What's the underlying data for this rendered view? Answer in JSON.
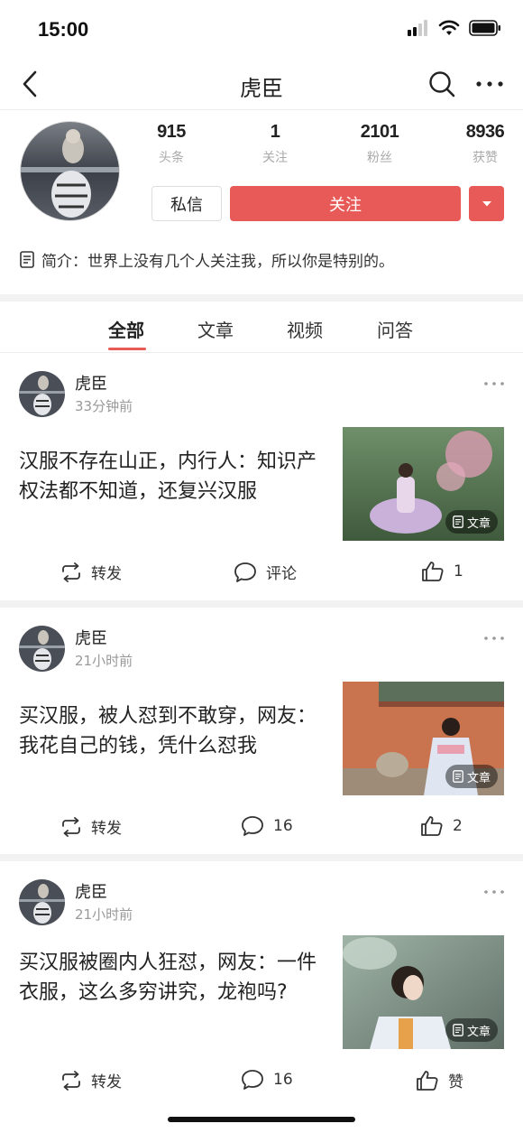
{
  "status_bar": {
    "time": "15:00"
  },
  "nav": {
    "title": "虎臣"
  },
  "profile": {
    "stats": [
      {
        "value": "915",
        "label": "头条"
      },
      {
        "value": "1",
        "label": "关注"
      },
      {
        "value": "2101",
        "label": "粉丝"
      },
      {
        "value": "8936",
        "label": "获赞"
      }
    ],
    "message_label": "私信",
    "follow_label": "关注",
    "bio": "简介：世界上没有几个人关注我，所以你是特别的。"
  },
  "tabs": [
    {
      "label": "全部",
      "active": true
    },
    {
      "label": "文章",
      "active": false
    },
    {
      "label": "视频",
      "active": false
    },
    {
      "label": "问答",
      "active": false
    }
  ],
  "posts": [
    {
      "author": "虎臣",
      "time": "33分钟前",
      "title": "汉服不存在山正，内行人：知识产权法都不知道，还复兴汉服",
      "badge": "文章",
      "repost_label": "转发",
      "comment_label": "评论",
      "like_label": "1"
    },
    {
      "author": "虎臣",
      "time": "21小时前",
      "title": "买汉服，被人怼到不敢穿，网友：我花自己的钱，凭什么怼我",
      "badge": "文章",
      "repost_label": "转发",
      "comment_label": "16",
      "like_label": "2"
    },
    {
      "author": "虎臣",
      "time": "21小时前",
      "title": "买汉服被圈内人狂怼，网友：一件衣服，这么多穷讲究，龙袍吗?",
      "badge": "文章",
      "repost_label": "转发",
      "comment_label": "16",
      "like_label": "赞"
    }
  ],
  "colors": {
    "accent": "#e85a57",
    "muted": "#999999",
    "divider": "#f2f2f2"
  }
}
